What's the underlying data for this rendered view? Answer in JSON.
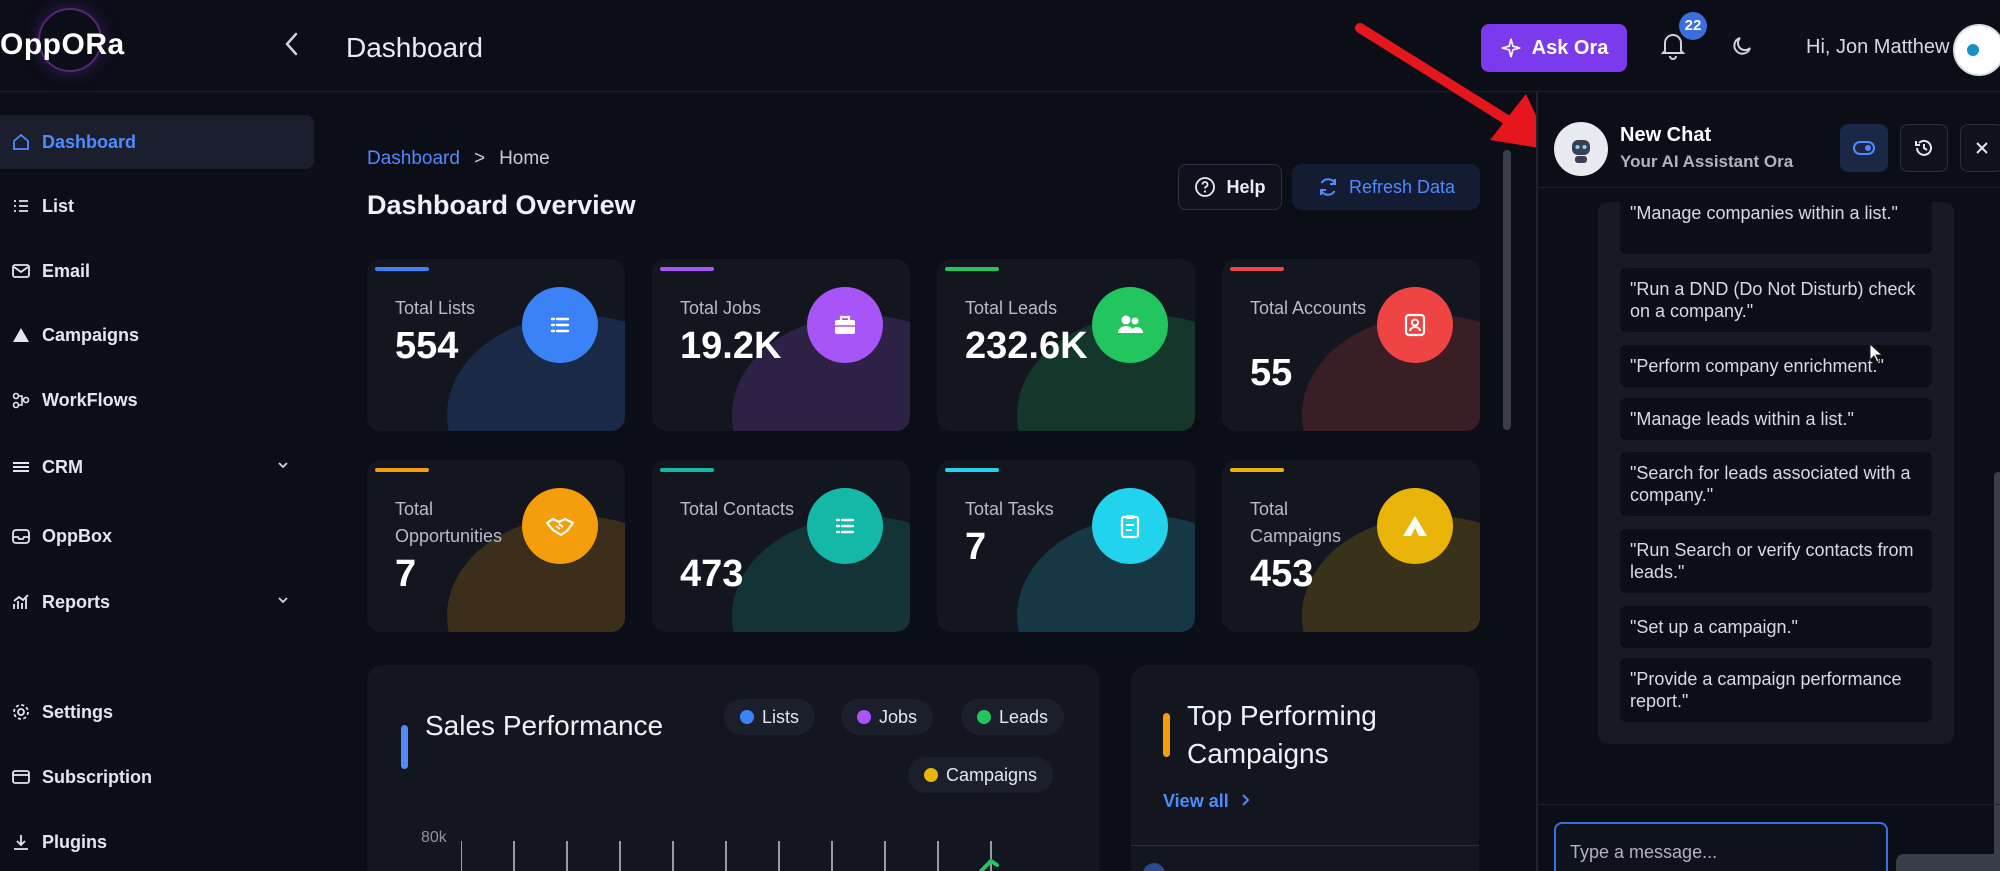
{
  "brand": {
    "logo_text": "OppORa"
  },
  "header": {
    "page_title": "Dashboard",
    "ask_label": "Ask Ora",
    "notification_count": "22",
    "greeting": "Hi, Jon Matthew"
  },
  "sidebar": {
    "items": [
      {
        "label": "Dashboard",
        "icon": "home-icon"
      },
      {
        "label": "List",
        "icon": "list-icon"
      },
      {
        "label": "Email",
        "icon": "mail-icon"
      },
      {
        "label": "Campaigns",
        "icon": "campaign-icon"
      },
      {
        "label": "WorkFlows",
        "icon": "workflow-icon"
      },
      {
        "label": "CRM",
        "icon": "crm-icon"
      },
      {
        "label": "OppBox",
        "icon": "inbox-icon"
      },
      {
        "label": "Reports",
        "icon": "reports-icon"
      },
      {
        "label": "Settings",
        "icon": "gear-icon"
      },
      {
        "label": "Subscription",
        "icon": "card-icon"
      },
      {
        "label": "Plugins",
        "icon": "download-icon"
      }
    ]
  },
  "main": {
    "breadcrumb": {
      "root": "Dashboard",
      "sep": ">",
      "current": "Home"
    },
    "title": "Dashboard Overview",
    "help_label": "Help",
    "refresh_label": "Refresh Data",
    "stats": [
      {
        "label": "Total Lists",
        "value": "554",
        "color": "#3b82f6"
      },
      {
        "label": "Total Jobs",
        "value": "19.2K",
        "color": "#a855f7"
      },
      {
        "label": "Total Leads",
        "value": "232.6K",
        "color": "#22c55e"
      },
      {
        "label": "Total Accounts",
        "value": "55",
        "color": "#ef4444"
      },
      {
        "label": "Total Opportunities",
        "value": "7",
        "color": "#f59e0b"
      },
      {
        "label": "Total Contacts",
        "value": "473",
        "color": "#14b8a6"
      },
      {
        "label": "Total Tasks",
        "value": "7",
        "color": "#22d3ee"
      },
      {
        "label": "Total Campaigns",
        "value": "453",
        "color": "#eab308"
      }
    ],
    "sales": {
      "title": "Sales Performance",
      "legend": [
        {
          "label": "Lists",
          "color": "#3b82f6"
        },
        {
          "label": "Jobs",
          "color": "#a855f7"
        },
        {
          "label": "Leads",
          "color": "#22c55e"
        },
        {
          "label": "Campaigns",
          "color": "#eab308"
        }
      ],
      "y_tick": "80k"
    },
    "top_campaigns": {
      "title": "Top Performing Campaigns",
      "view_all": "View all"
    }
  },
  "chat": {
    "title": "New Chat",
    "subtitle": "Your AI Assistant Ora",
    "suggestions": [
      "\"Manage companies within a list.\"",
      "\"Run a DND (Do Not Disturb) check on a company.\"",
      "\"Perform company enrichment.\"",
      "\"Manage leads within a list.\"",
      "\"Search for leads associated with a company.\"",
      "\"Run Search or verify contacts from leads.\"",
      "\"Set up a campaign.\"",
      "\"Provide a campaign performance report.\""
    ],
    "input_placeholder": "Type a message..."
  }
}
